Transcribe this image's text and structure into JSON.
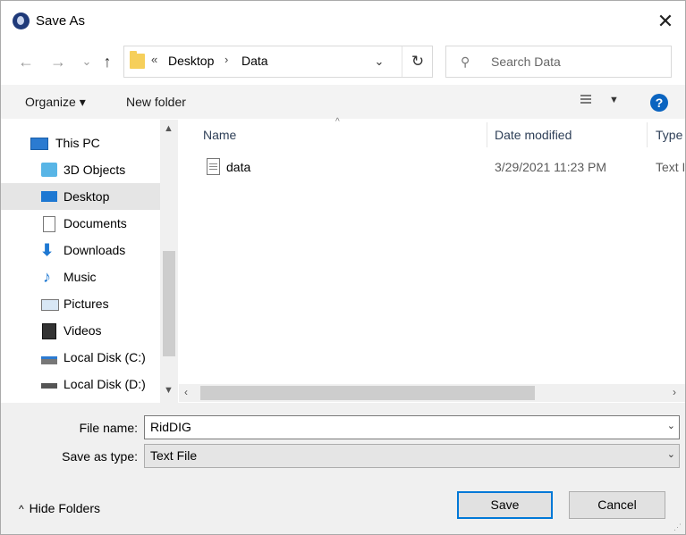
{
  "window": {
    "title": "Save As",
    "close_glyph": "✕",
    "app_icon": "app-globe-icon"
  },
  "nav": {
    "back_glyph": "←",
    "forward_glyph": "→",
    "recent_glyph": "⌄",
    "up_glyph": "↑",
    "breadcrumb": {
      "overflow": "«",
      "items": [
        "Desktop",
        "Data"
      ],
      "separator": "›"
    },
    "dropdown_glyph": "⌄",
    "refresh_glyph": "↻",
    "search_placeholder": "Search Data",
    "search_glyph": "⚲"
  },
  "toolbar": {
    "organize": "Organize ▾",
    "new_folder": "New folder",
    "view_dropdown": "▼",
    "help": "?"
  },
  "sidebar": {
    "items": [
      {
        "label": "This PC",
        "icon": "this-pc-icon",
        "selected": false
      },
      {
        "label": "3D Objects",
        "icon": "3d-objects-icon",
        "selected": false
      },
      {
        "label": "Desktop",
        "icon": "desktop-icon",
        "selected": true
      },
      {
        "label": "Documents",
        "icon": "documents-icon",
        "selected": false
      },
      {
        "label": "Downloads",
        "icon": "downloads-icon",
        "selected": false
      },
      {
        "label": "Music",
        "icon": "music-icon",
        "selected": false
      },
      {
        "label": "Pictures",
        "icon": "pictures-icon",
        "selected": false
      },
      {
        "label": "Videos",
        "icon": "videos-icon",
        "selected": false
      },
      {
        "label": "Local Disk (C:)",
        "icon": "local-disk-c-icon",
        "selected": false
      },
      {
        "label": "Local Disk (D:)",
        "icon": "local-disk-d-icon",
        "selected": false
      }
    ],
    "scroll_up": "▲",
    "scroll_down": "▼"
  },
  "files": {
    "columns": [
      "Name",
      "Date modified",
      "Type"
    ],
    "sort_glyph": "^",
    "rows": [
      {
        "name": "data",
        "date": "3/29/2021 11:23 PM",
        "type": "Text D"
      }
    ],
    "hscroll_left": "‹",
    "hscroll_right": "›"
  },
  "form": {
    "file_name_label": "File name:",
    "file_name_value": "RidDIG",
    "save_type_label": "Save as type:",
    "save_type_value": "Text File",
    "drop_glyph": "⌄"
  },
  "footer": {
    "hide_folders": "Hide Folders",
    "hide_glyph": "^",
    "save": "Save",
    "cancel": "Cancel"
  },
  "colors": {
    "accent": "#0078d7",
    "help": "#0b64c0",
    "selected": "#e5e5e5",
    "folder": "#f6cf5a"
  }
}
